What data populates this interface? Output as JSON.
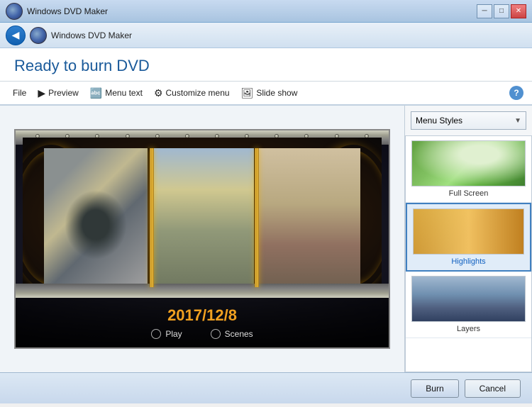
{
  "window": {
    "title": "Windows DVD Maker",
    "title_bar_buttons": [
      "minimize",
      "maximize",
      "close"
    ]
  },
  "nav": {
    "back_button": "◀",
    "app_title": "Windows DVD Maker"
  },
  "header": {
    "title": "Ready to burn DVD"
  },
  "toolbar": {
    "file_label": "File",
    "preview_label": "Preview",
    "menu_text_label": "Menu text",
    "customize_menu_label": "Customize menu",
    "slide_show_label": "Slide show",
    "help_label": "?"
  },
  "preview": {
    "date": "2017/12/8",
    "play_label": "Play",
    "scenes_label": "Scenes"
  },
  "styles_panel": {
    "dropdown_label": "Menu Styles",
    "items": [
      {
        "id": "full-screen",
        "label": "Full Screen",
        "selected": false
      },
      {
        "id": "highlights",
        "label": "Highlights",
        "selected": true
      },
      {
        "id": "layers",
        "label": "Layers",
        "selected": false
      }
    ]
  },
  "bottom": {
    "burn_label": "Burn",
    "cancel_label": "Cancel"
  },
  "dots": [
    "•",
    "•",
    "•",
    "•",
    "•",
    "•",
    "•",
    "•",
    "•",
    "•",
    "•",
    "•",
    "•",
    "•",
    "•"
  ]
}
